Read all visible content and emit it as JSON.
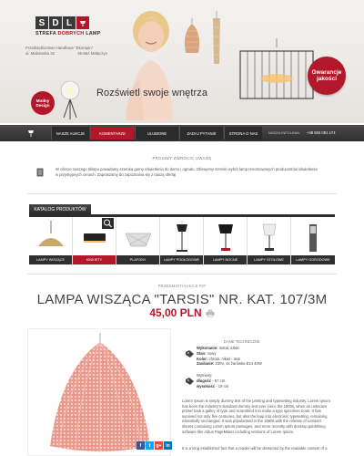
{
  "colors": {
    "accent": "#b3182a",
    "dark": "#2e2e2e",
    "nav": "#3a3a3a"
  },
  "header": {
    "logo_letters": [
      "S",
      "D",
      "L"
    ],
    "logo_sub_1": "STREFA",
    "logo_sub_2": "DOBRYCH",
    "logo_sub_3": "LAMP",
    "address_1": "Przedsiębiorstwo Handlowe \"Ekorepin\"",
    "address_2": "ul. Makowska 22",
    "address_3": "26-654 Małęczyn",
    "badge_modny_1": "Modny",
    "badge_modny_2": "Design",
    "badge_gwar_1": "Gwarancje",
    "badge_gwar_2": "jakości",
    "slogan": "Rozświetl swoje wnętrza"
  },
  "nav": {
    "items": [
      "NASZE AUKCJE",
      "KOMENTARZE",
      "ULUBIONE",
      "ZADAJ PYTANIE",
      "STRONA O NAS"
    ],
    "active_index": 1,
    "phone_label": "NASZA INFOLINIA:",
    "phone": "+48 504 081 174"
  },
  "notice": {
    "title": "PROSIMY ZWRÓCIĆ UWAGĘ",
    "text": "W ofercie naszego sklepu posiadamy szeroką gamę oświetlenia do domu i ogrodu. Oferujemy szeroki wybór lamp renomowanych producentów oświetlenia w przystępnych cenach. Zapraszamy do zapoznania się z naszą ofertą!"
  },
  "catalog": {
    "tab": "KATALOG PRODUKTÓW",
    "items": [
      "LAMPY WISZĄCE",
      "KINKIETY",
      "PLAFONY",
      "LAMPY PODŁOGOWE",
      "LAMPY NOCNE",
      "LAMPY STOŁOWE",
      "LAMPY OGRODOWE"
    ],
    "active_index": 1
  },
  "product": {
    "breadcrumb": "PRZEDMIOT/AUKCJI #37",
    "title": "LAMPA WISZĄCA \"TARSIS\" NR. KAT. 107/3M",
    "price": "45,00 PLN",
    "specs_title": "DANE TECHNICZNE",
    "spec1": [
      {
        "k": "Wykonanie:",
        "v": "metal, szkło"
      },
      {
        "k": "Stan:",
        "v": "nowy"
      },
      {
        "k": "Kolor:",
        "v": "chrom, nikiel - mat"
      },
      {
        "k": "Zasilanie:",
        "v": "230V, 4x żarówka E14 40W"
      }
    ],
    "spec2_title": "Wymiary:",
    "spec2": [
      {
        "k": "długość",
        "v": "- 57 cm"
      },
      {
        "k": "wysokość",
        "v": "- 19 cm"
      }
    ],
    "description": "Lorem Ipsum is simply dummy text of the printing and typesetting industry. Lorem Ipsum has been the industry's standard dummy text ever since the 1500s, when an unknown printer took a galley of type and scrambled it to make a type specimen book. It has survived not only five centuries, but also the leap into electronic typesetting, remaining essentially unchanged. It was popularised in the 1960s with the release of Letraset sheets containing Lorem Ipsum passages, and more recently with desktop publishing software like Aldus PageMaker including versions of Lorem Ipsum.",
    "description_2": "It is a long established fact that a reader will be distracted by the readable content of a"
  },
  "share": [
    "f",
    "t",
    "g+",
    "in"
  ]
}
